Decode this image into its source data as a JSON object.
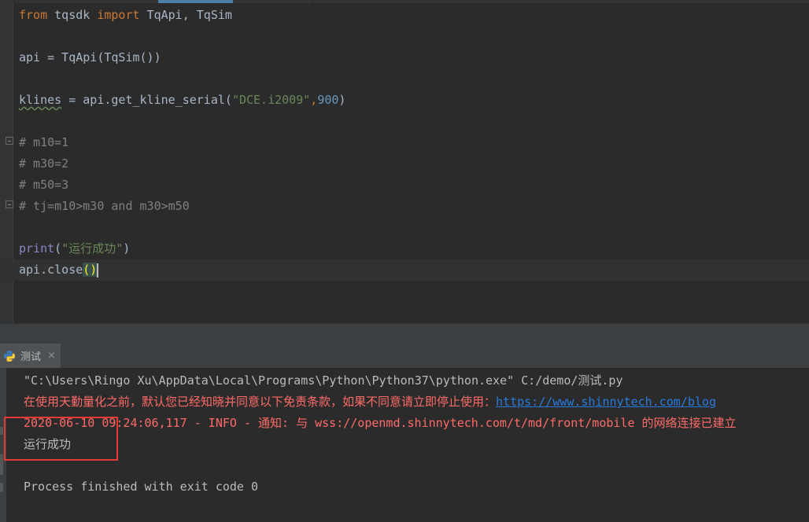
{
  "editor": {
    "lines": [
      {
        "segments": [
          {
            "t": "from",
            "c": "kw"
          },
          {
            "t": " tqsdk ",
            "c": ""
          },
          {
            "t": "import",
            "c": "kw"
          },
          {
            "t": " TqApi, TqSim",
            "c": ""
          }
        ]
      },
      {
        "segments": []
      },
      {
        "segments": [
          {
            "t": "api = TqApi(TqSim())",
            "c": ""
          }
        ]
      },
      {
        "segments": []
      },
      {
        "segments": [
          {
            "t": "klines",
            "c": "squig"
          },
          {
            "t": " = api.get_kline_serial(",
            "c": ""
          },
          {
            "t": "\"DCE.i2009\"",
            "c": "str"
          },
          {
            "t": ",",
            "c": "kw"
          },
          {
            "t": "900",
            "c": "num"
          },
          {
            "t": ")",
            "c": ""
          }
        ]
      },
      {
        "segments": []
      },
      {
        "segments": [
          {
            "t": "# m10=1",
            "c": "cmt"
          }
        ]
      },
      {
        "segments": [
          {
            "t": "# m30=2",
            "c": "cmt"
          }
        ]
      },
      {
        "segments": [
          {
            "t": "# m50=3",
            "c": "cmt"
          }
        ]
      },
      {
        "segments": [
          {
            "t": "# tj=m10>m30 and m30>m50",
            "c": "cmt"
          }
        ]
      },
      {
        "segments": []
      },
      {
        "segments": [
          {
            "t": "print",
            "c": "fn"
          },
          {
            "t": "(",
            "c": ""
          },
          {
            "t": "\"运行成功\"",
            "c": "str"
          },
          {
            "t": ")",
            "c": ""
          }
        ]
      },
      {
        "segments": [
          {
            "t": "api.close",
            "c": ""
          },
          {
            "t": "()",
            "c": "bracket"
          },
          {
            "t": "",
            "c": "caret"
          }
        ]
      }
    ]
  },
  "run_panel": {
    "tab_label": "测试",
    "close_icon": "×",
    "icon": "python-icon"
  },
  "console": {
    "command": "\"C:\\Users\\Ringo Xu\\AppData\\Local\\Programs\\Python\\Python37\\python.exe\" C:/demo/测试.py",
    "disclaimer": "在使用天勤量化之前，默认您已经知晓并同意以下免责条款，如果不同意请立即停止使用：",
    "disclaimer_link": "https://www.shinnytech.com/blog",
    "log_line": "2020-06-10 09:24:06,117 - INFO - 通知: 与 wss://openmd.shinnytech.com/t/md/front/mobile 的网络连接已建立",
    "output": "运行成功",
    "exit_message": "Process finished with exit code 0"
  },
  "colors": {
    "background": "#2b2b2b",
    "keyword": "#cc7832",
    "string": "#6a8759",
    "number": "#6897bb",
    "comment": "#808080",
    "error_text": "#ff6b68",
    "link": "#287bde",
    "highlight_box": "#e53935"
  }
}
